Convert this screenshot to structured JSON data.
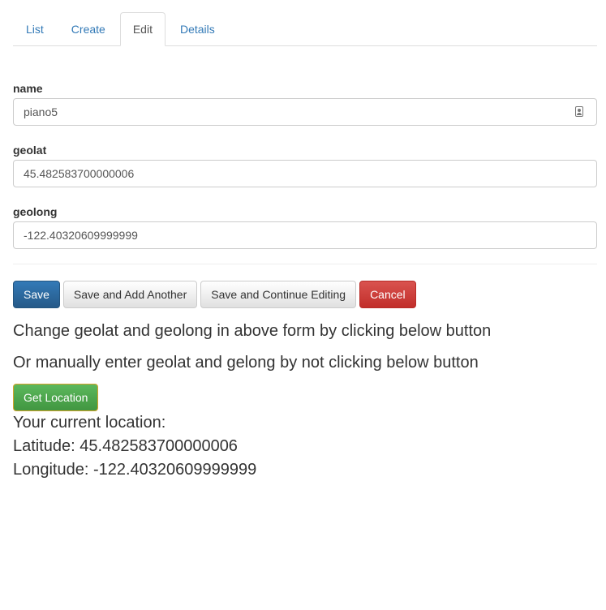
{
  "tabs": [
    {
      "label": "List"
    },
    {
      "label": "Create"
    },
    {
      "label": "Edit"
    },
    {
      "label": "Details"
    }
  ],
  "form": {
    "name": {
      "label": "name",
      "value": "piano5"
    },
    "geolat": {
      "label": "geolat",
      "value": "45.482583700000006"
    },
    "geolong": {
      "label": "geolong",
      "value": "-122.40320609999999"
    }
  },
  "actions": {
    "save": "Save",
    "save_add": "Save and Add Another",
    "save_continue": "Save and Continue Editing",
    "cancel": "Cancel"
  },
  "info": {
    "line1": "Change geolat and geolong in above form by clicking below button",
    "line2": "Or manually enter geolat and gelong by not clicking below button",
    "get_location": "Get Location",
    "current_heading": "Your current location:",
    "latitude": "Latitude: 45.482583700000006",
    "longitude": "Longitude: -122.40320609999999"
  },
  "colors": {
    "link": "#337ab7",
    "primary": "#337ab7",
    "danger": "#d9534f",
    "success": "#5cb85c"
  }
}
